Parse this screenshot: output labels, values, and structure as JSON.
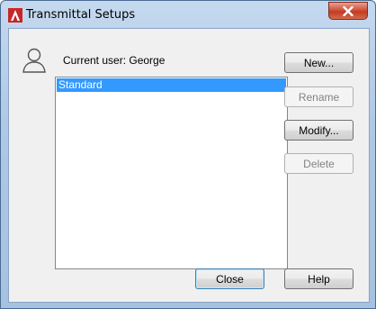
{
  "window": {
    "title": "Transmittal Setups",
    "close_glyph": "x"
  },
  "user": {
    "label": "Current user: George",
    "icon": "user-icon"
  },
  "setups": {
    "items": [
      "Standard"
    ],
    "selected": "Standard"
  },
  "buttons": {
    "new": "New...",
    "rename": "Rename",
    "modify": "Modify...",
    "delete": "Delete",
    "close": "Close",
    "help": "Help"
  },
  "colors": {
    "selection": "#3399ff",
    "app_icon": "#d32f2f"
  }
}
